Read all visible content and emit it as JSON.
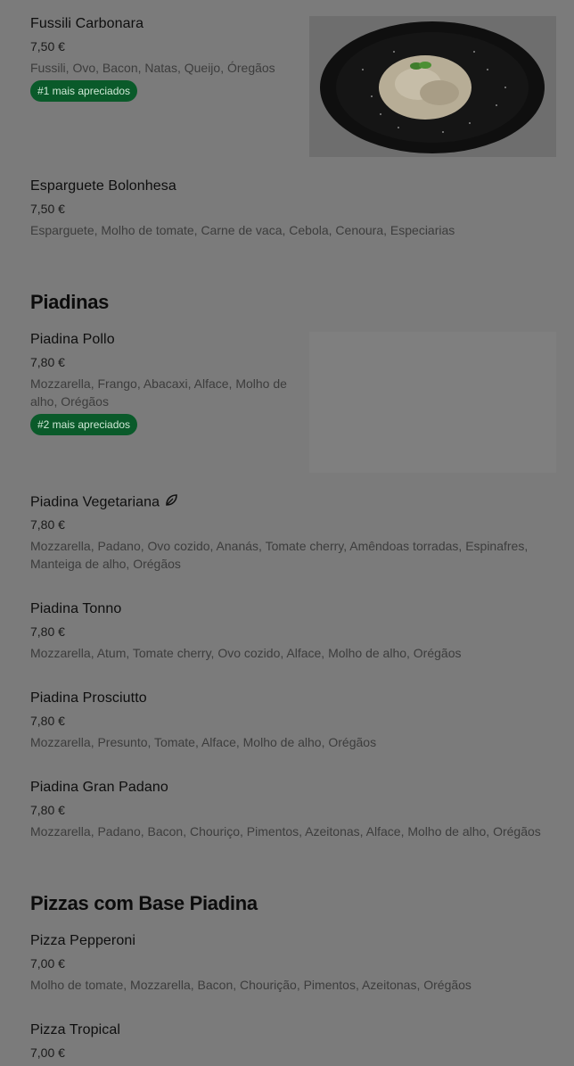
{
  "items": {
    "fussili": {
      "name": "Fussili Carbonara",
      "price": "7,50 €",
      "desc": "Fussili, Ovo, Bacon, Natas, Queijo, Óregãos",
      "badge": "#1 mais apreciados"
    },
    "bolonhesa": {
      "name": "Esparguete Bolonhesa",
      "price": "7,50 €",
      "desc": "Esparguete, Molho de tomate, Carne de vaca, Cebola, Cenoura, Especiarias"
    },
    "pollo": {
      "name": "Piadina Pollo",
      "price": "7,80 €",
      "desc": "Mozzarella, Frango, Abacaxi, Alface, Molho de alho, Orégãos",
      "badge": "#2 mais apreciados"
    },
    "vegetariana": {
      "name": "Piadina Vegetariana",
      "price": "7,80 €",
      "desc": "Mozzarella, Padano, Ovo cozido, Ananás, Tomate cherry, Amêndoas torradas, Espinafres, Manteiga de alho, Orégãos",
      "icon": "leaf-icon"
    },
    "tonno": {
      "name": "Piadina Tonno",
      "price": "7,80 €",
      "desc": "Mozzarella, Atum, Tomate cherry, Ovo cozido, Alface, Molho de alho, Orégãos"
    },
    "prosciutto": {
      "name": "Piadina Prosciutto",
      "price": "7,80 €",
      "desc": "Mozzarella, Presunto, Tomate, Alface, Molho de alho, Orégãos"
    },
    "granpadano": {
      "name": "Piadina Gran Padano",
      "price": "7,80 €",
      "desc": "Mozzarella, Padano, Bacon, Chouriço, Pimentos, Azeitonas, Alface, Molho de alho, Orégãos"
    },
    "pepperoni": {
      "name": "Pizza Pepperoni",
      "price": "7,00 €",
      "desc": "Molho de tomate, Mozzarella, Bacon, Chourição, Pimentos, Azeitonas, Orégãos"
    },
    "tropical": {
      "name": "Pizza Tropical",
      "price": "7,00 €"
    }
  },
  "sections": {
    "piadinas": "Piadinas",
    "pizzas_base": "Pizzas com Base Piadina"
  },
  "colors": {
    "overlay_bg": "#7b7b7b",
    "badge_bg": "#0a5a2a"
  }
}
